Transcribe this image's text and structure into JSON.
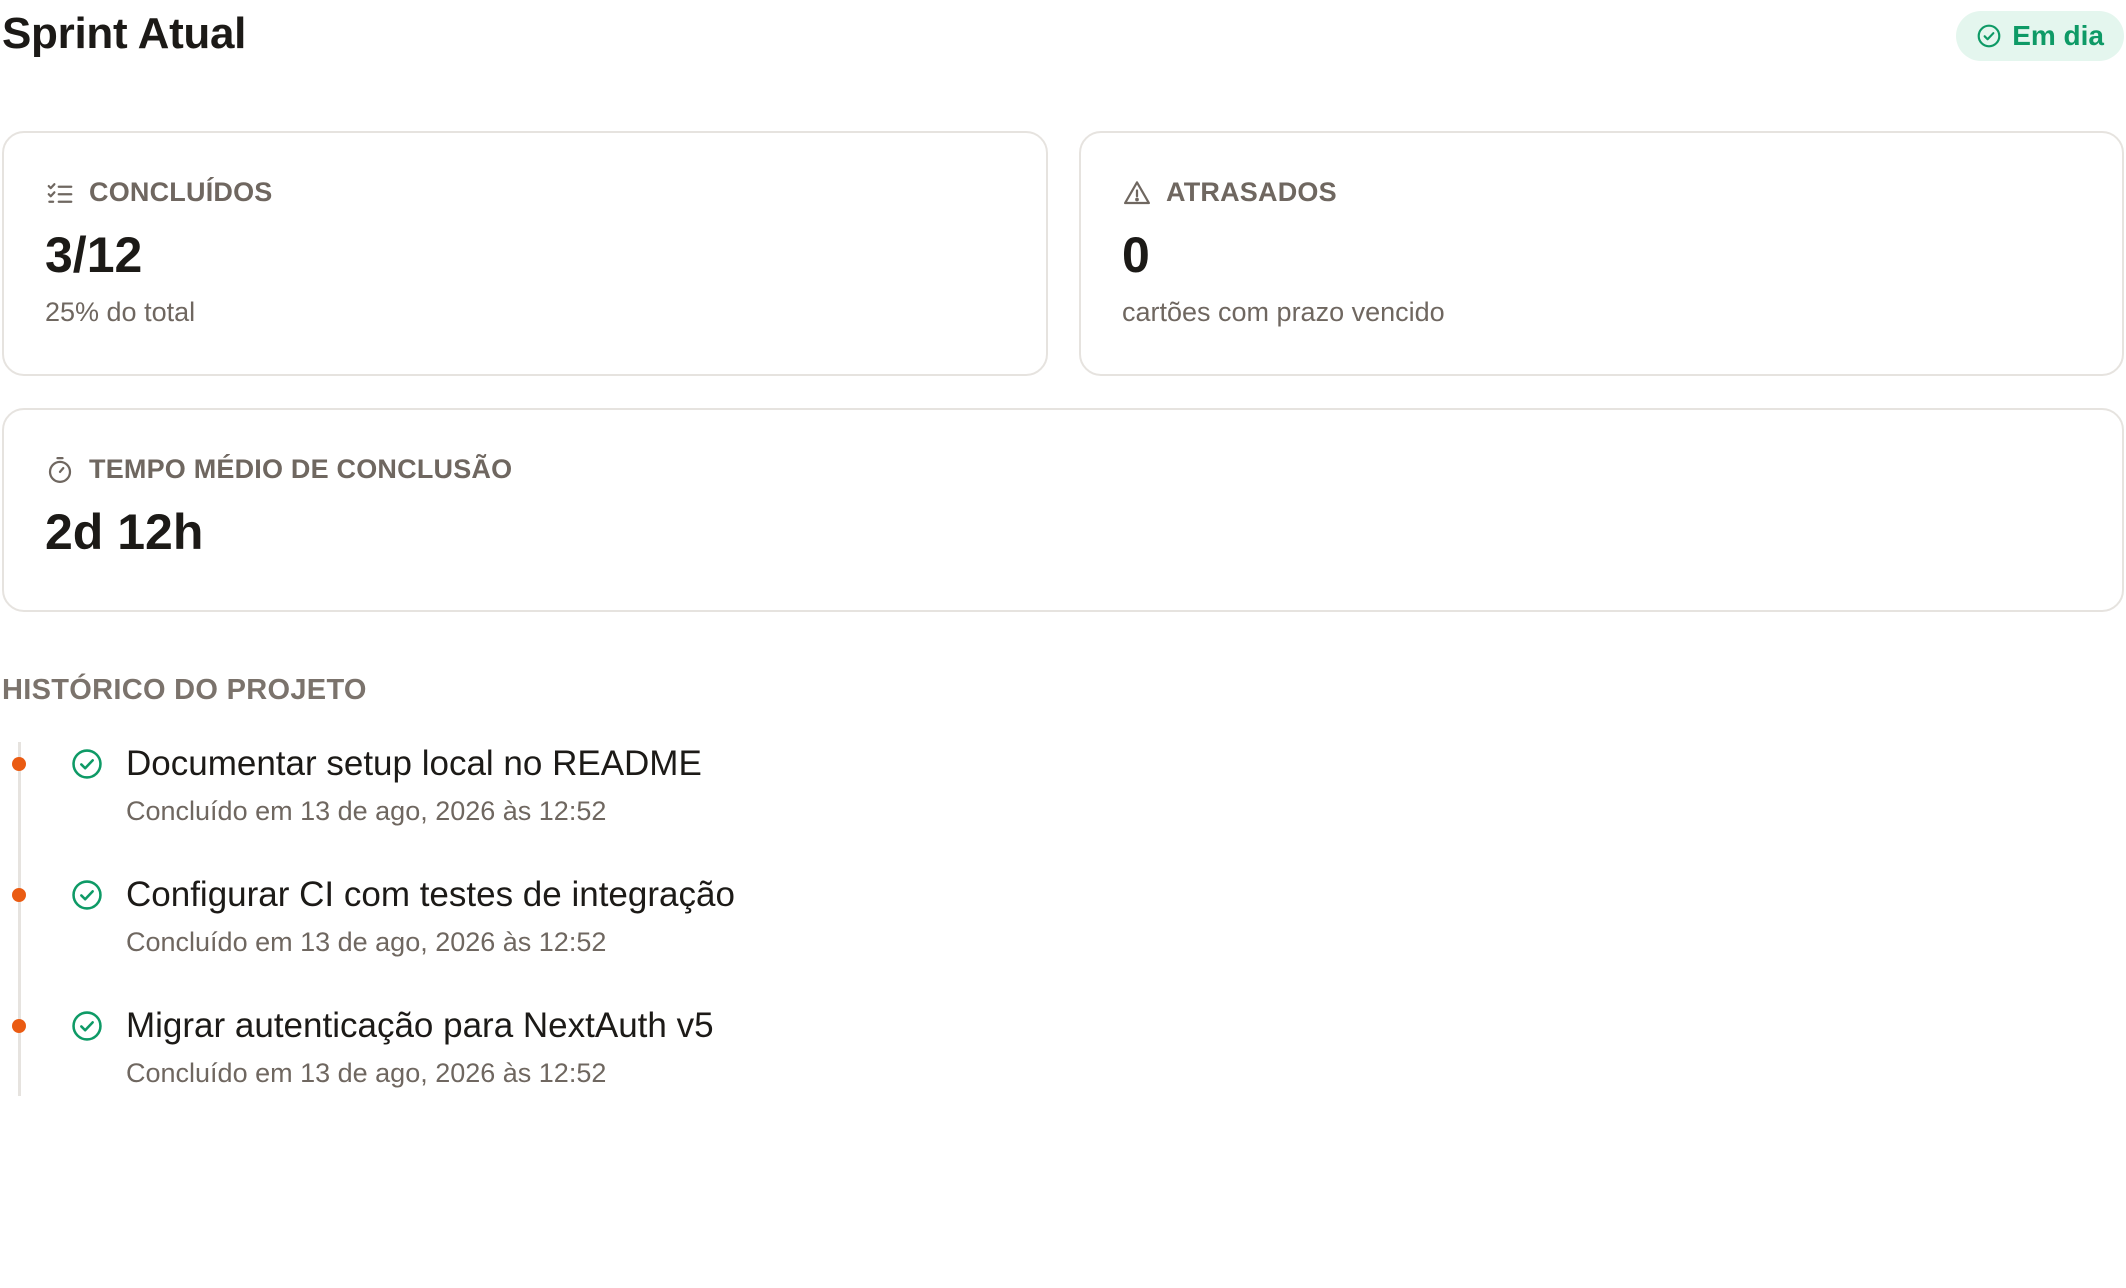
{
  "header": {
    "title": "Sprint Atual",
    "status_label": "Em dia",
    "status_icon": "check-circle-icon"
  },
  "cards": {
    "done": {
      "icon": "list-check-icon",
      "label": "CONCLUÍDOS",
      "value": "3/12",
      "sub": "25% do total"
    },
    "late": {
      "icon": "warning-triangle-icon",
      "label": "ATRASADOS",
      "value": "0",
      "sub": "cartões com prazo vencido"
    },
    "avg_time": {
      "icon": "stopwatch-icon",
      "label": "TEMPO MÉDIO DE CONCLUSÃO",
      "value": "2d 12h"
    }
  },
  "history": {
    "title": "HISTÓRICO DO PROJETO",
    "items": [
      {
        "title": "Documentar setup local no README",
        "meta": "Concluído em 13 de ago, 2026 às 12:52"
      },
      {
        "title": "Configurar CI com testes de integração",
        "meta": "Concluído em 13 de ago, 2026 às 12:52"
      },
      {
        "title": "Migrar autenticação para NextAuth v5",
        "meta": "Concluído em 13 de ago, 2026 às 12:52"
      }
    ]
  },
  "colors": {
    "accent_green": "#0e9a66",
    "status_bg": "#e4f6ee",
    "timeline_dot": "#ea5b12",
    "muted_text": "#6f6760",
    "border": "#e6e3df"
  }
}
